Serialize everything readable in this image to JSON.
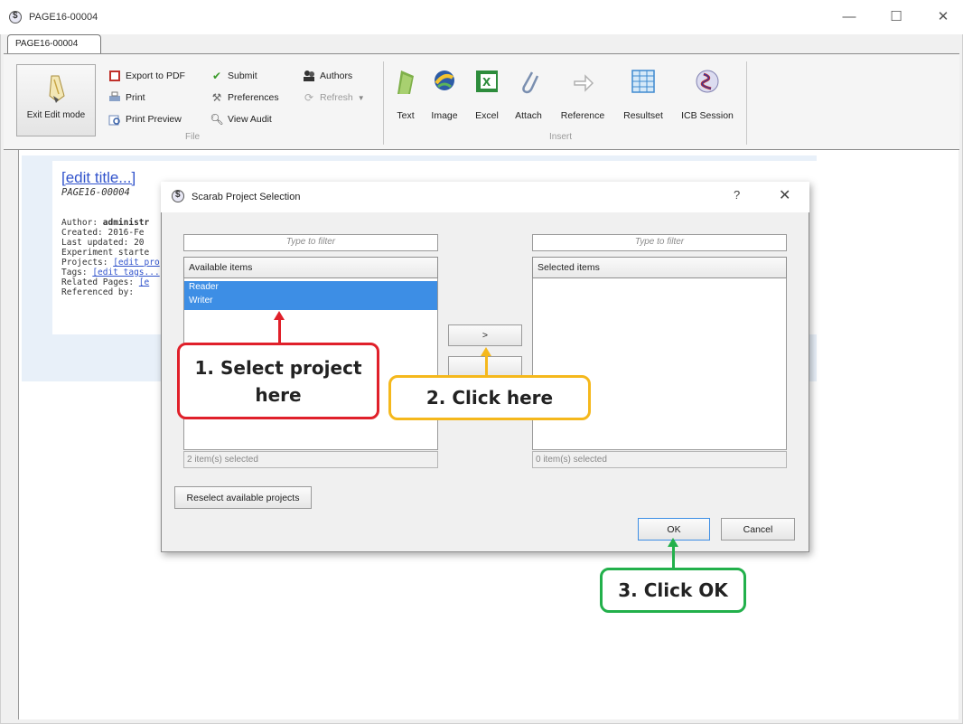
{
  "window": {
    "title": "PAGE16-00004",
    "tab": "PAGE16-00004",
    "controls": {
      "minimize": "—",
      "maximize": "☐",
      "close": "✕"
    }
  },
  "ribbon": {
    "exit_edit": "Exit Edit mode",
    "file_group": {
      "label": "File",
      "export_pdf": "Export to PDF",
      "print": "Print",
      "print_preview": "Print Preview",
      "submit": "Submit",
      "preferences": "Preferences",
      "view_audit": "View Audit",
      "authors": "Authors",
      "refresh": "Refresh"
    },
    "insert_group": {
      "label": "Insert",
      "items": [
        "Text",
        "Image",
        "Excel",
        "Attach",
        "Reference",
        "Resultset",
        "ICB Session"
      ]
    }
  },
  "page": {
    "edit_title": "[edit title...]",
    "page_id": "PAGE16-00004",
    "meta": {
      "author_label": "Author: ",
      "author_value": "administr",
      "created": "Created: 2016-Fe",
      "updated": "Last updated: 20",
      "experiment": "Experiment starte",
      "projects_label": "Projects: ",
      "projects_link": "[edit pro",
      "tags_label": "Tags: ",
      "tags_link": "[edit tags...",
      "related_label": "Related Pages: ",
      "related_link": "[e",
      "referenced": "Referenced by:"
    }
  },
  "dialog": {
    "title": "Scarab Project Selection",
    "help": "?",
    "close": "✕",
    "left": {
      "filter_placeholder": "Type to filter",
      "header": "Available items",
      "items": [
        "Reader",
        "Writer"
      ],
      "status": "2 item(s) selected"
    },
    "right": {
      "filter_placeholder": "Type to filter",
      "header": "Selected items",
      "status": "0 item(s) selected"
    },
    "move_right": ">",
    "reselect": "Reselect available projects",
    "ok": "OK",
    "cancel": "Cancel"
  },
  "callouts": {
    "step1_line1": "1. Select project",
    "step1_line2": "here",
    "step2": "2. Click here",
    "step3": "3. Click OK"
  },
  "colors": {
    "step1": "#e0202a",
    "step2": "#f5b81c",
    "step3": "#22b04b",
    "selection": "#3d8ee5",
    "link": "#3254cc"
  }
}
